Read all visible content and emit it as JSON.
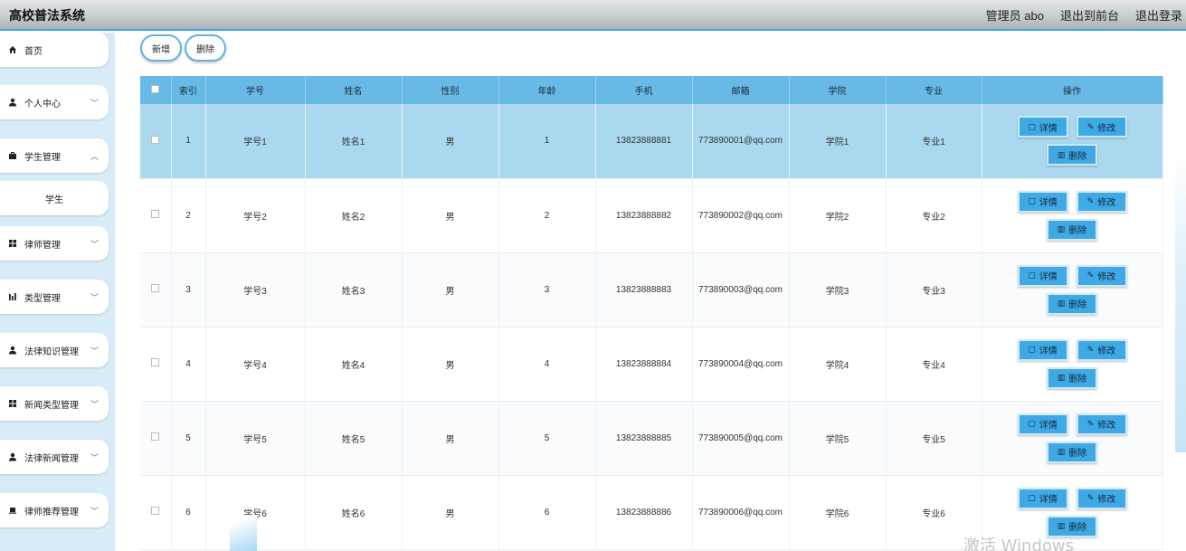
{
  "header": {
    "title": "高校普法系统",
    "admin_label": "管理员 abo",
    "front_label": "退出到前台",
    "logout_label": "退出登录"
  },
  "sidebar": {
    "items": [
      {
        "label": "首页",
        "icon": "home-icon",
        "chevron": false
      },
      {
        "label": "个人中心",
        "icon": "person-icon",
        "chevron": true
      },
      {
        "label": "学生管理",
        "icon": "briefcase-icon",
        "chevron": true
      },
      {
        "label": "学生",
        "icon": "",
        "chevron": false
      },
      {
        "label": "律师管理",
        "icon": "grid-icon",
        "chevron": true
      },
      {
        "label": "类型管理",
        "icon": "bar-chart-icon",
        "chevron": true
      },
      {
        "label": "法律知识管理",
        "icon": "person-icon",
        "chevron": true
      },
      {
        "label": "新闻类型管理",
        "icon": "grid-icon",
        "chevron": true
      },
      {
        "label": "法律新闻管理",
        "icon": "person-icon",
        "chevron": true
      },
      {
        "label": "律师推荐管理",
        "icon": "laptop-icon",
        "chevron": true
      }
    ]
  },
  "toolbar": {
    "add_label": "新增",
    "delete_label": "删除"
  },
  "table": {
    "headers": [
      "索引",
      "学号",
      "姓名",
      "性别",
      "年龄",
      "手机",
      "邮箱",
      "学院",
      "专业",
      "操作"
    ],
    "rows": [
      {
        "index": "1",
        "id": "学号1",
        "name": "姓名1",
        "gender": "男",
        "age": "1",
        "phone": "13823888881",
        "email": "773890001@qq.com",
        "college": "学院1",
        "major": "专业1"
      },
      {
        "index": "2",
        "id": "学号2",
        "name": "姓名2",
        "gender": "男",
        "age": "2",
        "phone": "13823888882",
        "email": "773890002@qq.com",
        "college": "学院2",
        "major": "专业2"
      },
      {
        "index": "3",
        "id": "学号3",
        "name": "姓名3",
        "gender": "男",
        "age": "3",
        "phone": "13823888883",
        "email": "773890003@qq.com",
        "college": "学院3",
        "major": "专业3"
      },
      {
        "index": "4",
        "id": "学号4",
        "name": "姓名4",
        "gender": "男",
        "age": "4",
        "phone": "13823888884",
        "email": "773890004@qq.com",
        "college": "学院4",
        "major": "专业4"
      },
      {
        "index": "5",
        "id": "学号5",
        "name": "姓名5",
        "gender": "男",
        "age": "5",
        "phone": "13823888885",
        "email": "773890005@qq.com",
        "college": "学院5",
        "major": "专业5"
      },
      {
        "index": "6",
        "id": "学号6",
        "name": "姓名6",
        "gender": "男",
        "age": "6",
        "phone": "13823888886",
        "email": "773890006@qq.com",
        "college": "学院6",
        "major": "专业6"
      }
    ],
    "ops": {
      "detail": "详情",
      "edit": "修改",
      "delete": "删除"
    }
  },
  "watermark": "激活 Windows",
  "colors": {
    "accent": "#3fa9e6",
    "header_row": "#68b9e6",
    "selected_row": "#aad9ef",
    "sidebar_bg": "#d8ecf7"
  }
}
